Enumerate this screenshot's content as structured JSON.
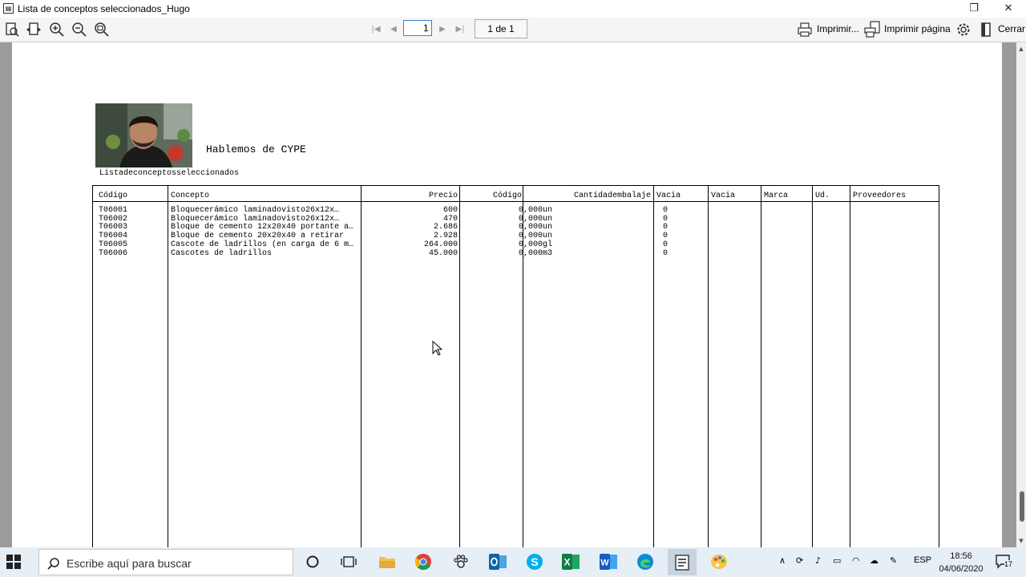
{
  "window": {
    "title": "Lista de conceptos seleccionados_Hugo",
    "app_icon": "report-icon"
  },
  "toolbar": {
    "current_page": "1",
    "page_count": "1 de 1",
    "print_label": "Imprimir...",
    "print_page_label": "Imprimir página",
    "close_label": "Cerrar"
  },
  "report": {
    "company": "Hablemos de CYPE",
    "subtitle": "Listadeconceptosseleccionados",
    "headers": [
      "Código",
      "Concepto",
      "Precio",
      "Código",
      "Cantidadembalaje",
      "Vacia",
      "Vacia",
      "Marca",
      "Ud.",
      "Proveedores"
    ],
    "rows": [
      {
        "codigo": "T06001",
        "concepto": "Bloquecerámico laminadovisto26x12x…",
        "precio": "600",
        "codigo2": "0,000un",
        "vacia": "0"
      },
      {
        "codigo": "T06002",
        "concepto": "Bloquecerámico laminadovisto26x12x…",
        "precio": "470",
        "codigo2": "0,000un",
        "vacia": "0"
      },
      {
        "codigo": "T06003",
        "concepto": "Bloque de cemento 12x20x40 portante a…",
        "precio": "2.686",
        "codigo2": "0,000un",
        "vacia": "0"
      },
      {
        "codigo": "T06004",
        "concepto": "Bloque de cemento 20x20x40 a retirar",
        "precio": "2.928",
        "codigo2": "0,000un",
        "vacia": "0"
      },
      {
        "codigo": "T06005",
        "concepto": "Cascote de ladrillos (en carga de 6 m…",
        "precio": "264.000",
        "codigo2": "0,000gl",
        "vacia": "0"
      },
      {
        "codigo": "T06006",
        "concepto": "Cascotes de ladrillos",
        "precio": "45.000",
        "codigo2": "0,000m3",
        "vacia": "0"
      }
    ]
  },
  "taskbar": {
    "search_placeholder": "Escribe aquí para buscar",
    "language": "ESP",
    "time": "18:56",
    "date": "04/06/2020",
    "notifications": "17"
  }
}
